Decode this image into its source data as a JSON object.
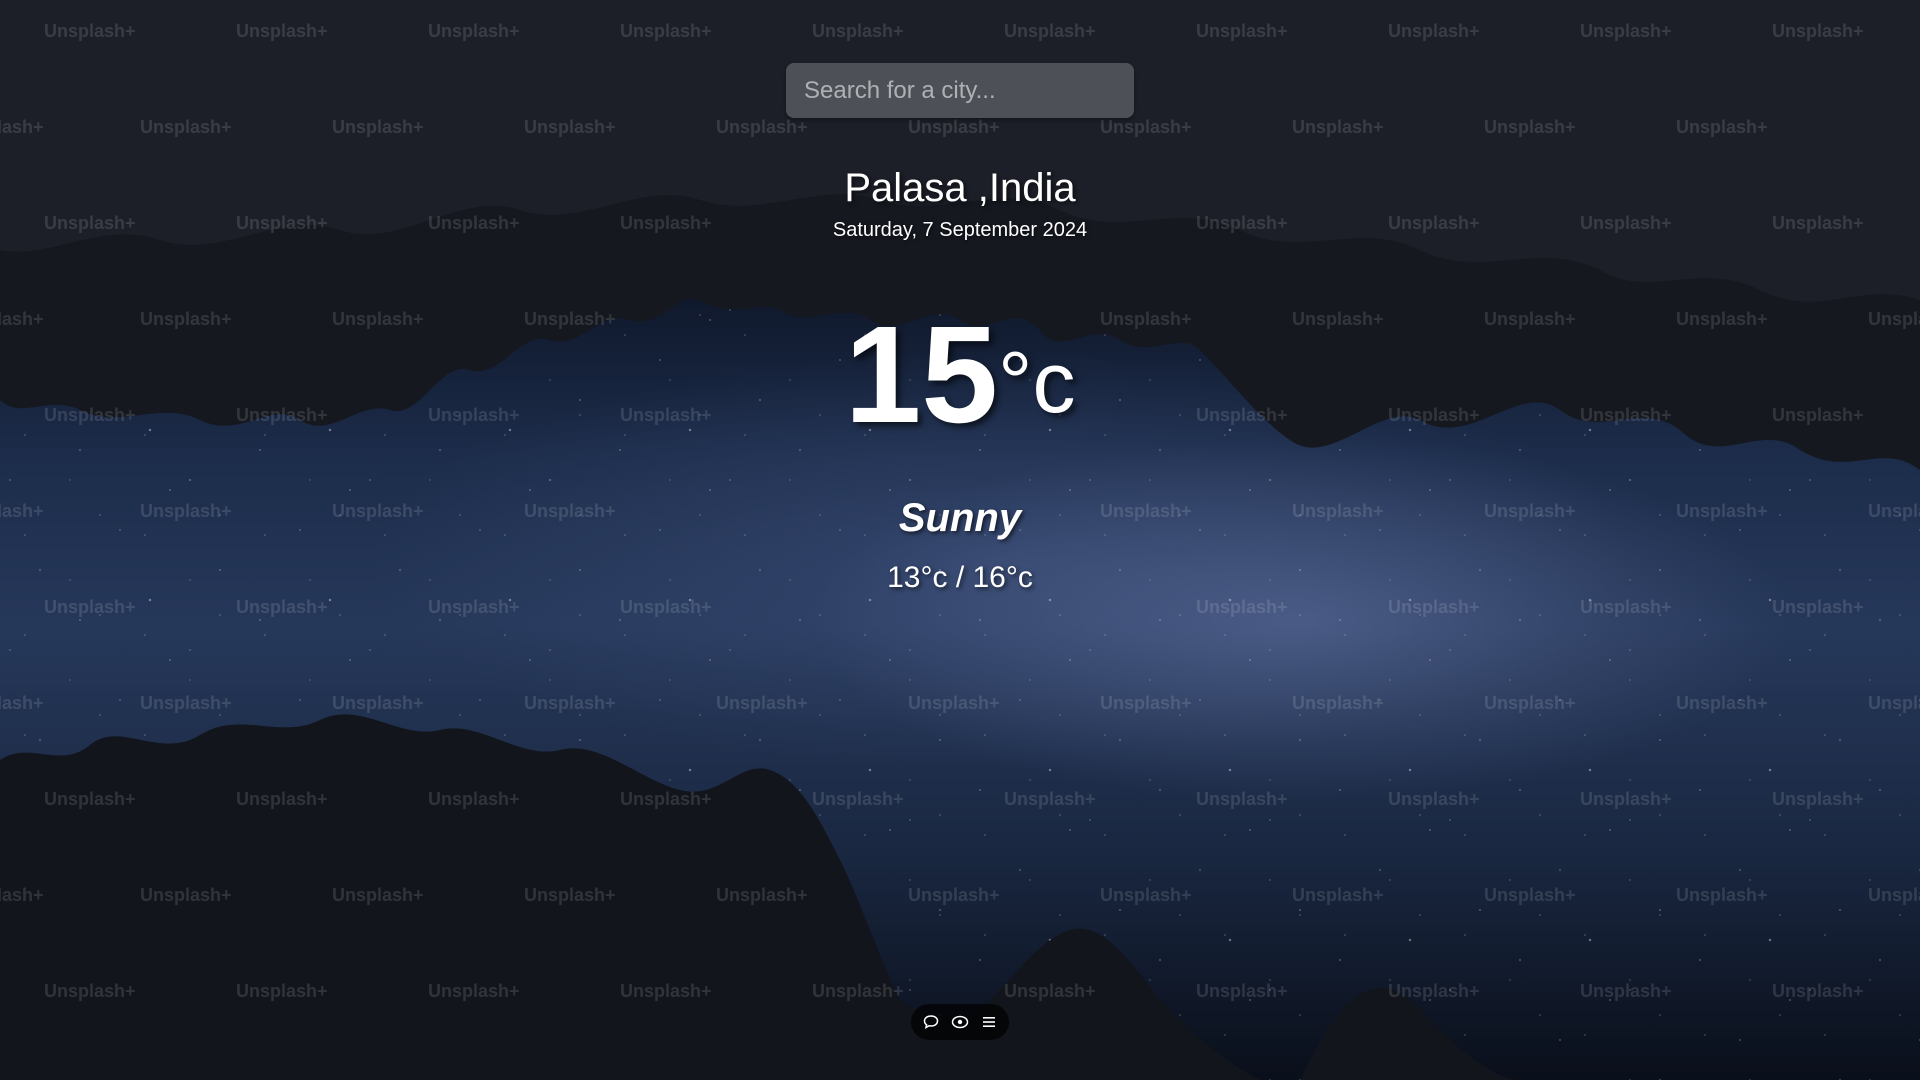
{
  "search": {
    "placeholder": "Search for a city..."
  },
  "weather": {
    "location": "Palasa ,India",
    "date": "Saturday, 7 September 2024",
    "temperature": "15",
    "unit": "°c",
    "condition": "Sunny",
    "hilow": "13°c / 16°c"
  },
  "watermark": {
    "text": "Unsplash+"
  },
  "toolbar": {
    "icons": [
      "chat-icon",
      "eye-icon",
      "menu-icon"
    ]
  },
  "colors": {
    "text": "#ffffff",
    "search_bg": "rgba(255,255,255,0.22)",
    "toolbar_bg": "#000000"
  }
}
